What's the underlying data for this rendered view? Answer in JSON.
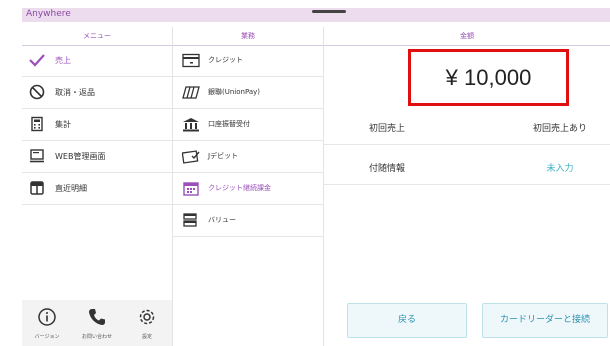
{
  "app": {
    "title": "Anywhere"
  },
  "headers": {
    "menu": "メニュー",
    "business": "業務",
    "amount": "金額"
  },
  "menu": {
    "items": [
      {
        "label": "売上",
        "icon": "checkmark-icon",
        "selected": true
      },
      {
        "label": "取消・返品",
        "icon": "cancel-icon",
        "selected": false
      },
      {
        "label": "集計",
        "icon": "calculator-icon",
        "selected": false
      },
      {
        "label": "WEB管理画面",
        "icon": "monitor-icon",
        "selected": false
      },
      {
        "label": "直近明細",
        "icon": "receipt-icon",
        "selected": false
      }
    ],
    "footer": [
      {
        "label": "バージョン",
        "icon": "info-icon"
      },
      {
        "label": "お問い合わせ",
        "icon": "phone-icon"
      },
      {
        "label": "設定",
        "icon": "gear-icon"
      }
    ]
  },
  "business": {
    "items": [
      {
        "label": "クレジット",
        "icon": "credit-card-icon",
        "selected": false
      },
      {
        "label": "銀聯(UnionPay)",
        "icon": "unionpay-card-icon",
        "selected": false
      },
      {
        "label": "口座振替受付",
        "icon": "bank-icon",
        "selected": false
      },
      {
        "label": "Jデビット",
        "icon": "jdebit-card-icon",
        "selected": false
      },
      {
        "label": "クレジット継続課金",
        "icon": "calendar-icon",
        "selected": true
      },
      {
        "label": "バリュー",
        "icon": "value-card-icon",
        "selected": false
      }
    ]
  },
  "amount": {
    "value": "¥ 10,000"
  },
  "info": [
    {
      "key": "初回売上",
      "value": "初回売上あり"
    },
    {
      "key": "付随情報",
      "value": "未入力"
    }
  ],
  "buttons": {
    "back": "戻る",
    "connect": "カードリーダーと接続"
  },
  "colors": {
    "accent": "#9b4fb8",
    "link": "#3bb0c8",
    "highlight": "#e01010",
    "titlebar": "#eddcee"
  }
}
